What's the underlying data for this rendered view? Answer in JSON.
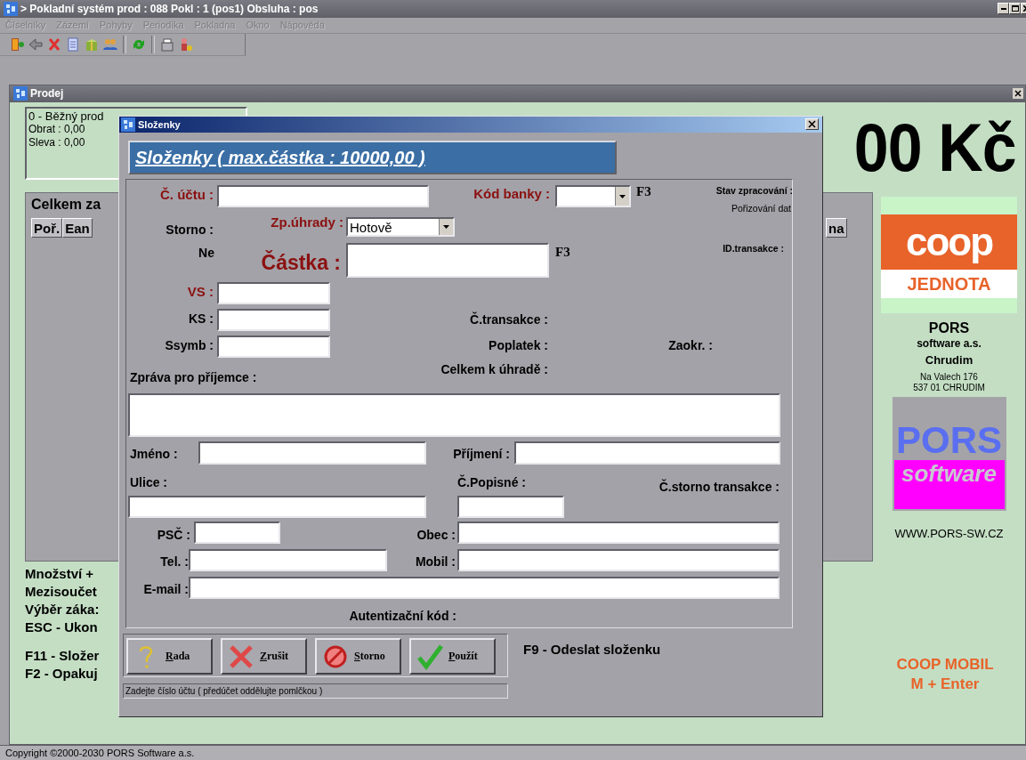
{
  "window": {
    "title": "> Pokladní systém prod : 088 Pokl : 1 (pos1) Obsluha : pos"
  },
  "menu": [
    {
      "label": "Číselníky",
      "disabled": true
    },
    {
      "label": "Zázemí",
      "disabled": true
    },
    {
      "label": "Pohyby",
      "disabled": true
    },
    {
      "label": "Periodika",
      "disabled": true
    },
    {
      "label": "Pokladna",
      "disabled": true
    },
    {
      "label": "Okno",
      "disabled": true
    },
    {
      "label": "Nápověda",
      "disabled": true
    }
  ],
  "sales_window": {
    "title": "Prodej",
    "info": [
      "0 - Běžný prod",
      "Obrat : 0,00",
      "Sleva : 0,00"
    ],
    "total": "00 Kč",
    "panel": {
      "title": "Celkem za",
      "columns": [
        "Poř.",
        "Ean",
        "na"
      ]
    },
    "shortcuts": [
      "Množství +",
      "Mezisoučet",
      "Výběr záka:",
      "ESC - Ukon",
      "F11 - Složer",
      "F2 - Opakuj"
    ],
    "vendor": {
      "store_logo": {
        "mark": "coop",
        "name": "JEDNOTA"
      },
      "company": "PORS",
      "company_sub": "software a.s.",
      "city": "Chrudim",
      "address": [
        "Na Valech 176",
        "537 01 CHRUDIM"
      ],
      "software_logo": {
        "mark": "PORS",
        "sub": "software"
      },
      "web": "WWW.PORS-SW.CZ"
    },
    "promo": [
      "COOP MOBIL",
      "M + Enter"
    ]
  },
  "dialog": {
    "title": "Složenky",
    "heading": "Složenky ( max.částka : 10000,00 )",
    "items": [
      {
        "kind": "required",
        "text": "Č. účtu :"
      },
      {
        "kind": "input"
      },
      {
        "kind": "required",
        "text": "Kód banky :"
      },
      {
        "kind": "select"
      },
      {
        "kind": "key",
        "text": "F3"
      },
      {
        "kind": "caption",
        "text": "Stav zpracování :"
      },
      {
        "kind": "note",
        "text": "Pořizování dat"
      },
      {
        "kind": "label",
        "text": "Storno :"
      },
      {
        "kind": "required",
        "text": "Zp.úhrady :"
      },
      {
        "kind": "select",
        "value": "Hotově"
      },
      {
        "kind": "label",
        "text": "Ne"
      },
      {
        "kind": "heading",
        "text": "Částka :"
      },
      {
        "kind": "input"
      },
      {
        "kind": "key",
        "text": "F3"
      },
      {
        "kind": "caption",
        "text": "ID.transakce :"
      },
      {
        "kind": "required",
        "text": "VS :"
      },
      {
        "kind": "input"
      },
      {
        "kind": "label",
        "text": "KS :"
      },
      {
        "kind": "input"
      },
      {
        "kind": "label",
        "text": "Ssymb :"
      },
      {
        "kind": "input"
      },
      {
        "kind": "label",
        "text": "Č.transakce :"
      },
      {
        "kind": "label",
        "text": "Poplatek :"
      },
      {
        "kind": "label",
        "text": "Zaokr. :"
      },
      {
        "kind": "label",
        "text": "Zpráva pro příjemce :"
      },
      {
        "kind": "label",
        "text": "Celkem k úhradě :"
      },
      {
        "kind": "textarea"
      },
      {
        "kind": "label",
        "text": "Jméno :"
      },
      {
        "kind": "input"
      },
      {
        "kind": "label",
        "text": "Příjmení :"
      },
      {
        "kind": "input"
      },
      {
        "kind": "label",
        "text": "Ulice :"
      },
      {
        "kind": "label",
        "text": "Č.Popisné :"
      },
      {
        "kind": "label",
        "text": "Č.storno transakce :"
      },
      {
        "kind": "input"
      },
      {
        "kind": "input"
      },
      {
        "kind": "label",
        "text": "PSČ :"
      },
      {
        "kind": "input"
      },
      {
        "kind": "label",
        "text": "Obec :"
      },
      {
        "kind": "input"
      },
      {
        "kind": "label",
        "text": "Tel. :"
      },
      {
        "kind": "input"
      },
      {
        "kind": "label",
        "text": "Mobil :"
      },
      {
        "kind": "input"
      },
      {
        "kind": "label",
        "text": "E-mail :"
      },
      {
        "kind": "input"
      },
      {
        "kind": "label",
        "text": "Autentizační kód :"
      }
    ],
    "buttons": [
      {
        "label": "Rada"
      },
      {
        "label": "Zrušit"
      },
      {
        "label": "Storno"
      },
      {
        "label": "Použít"
      }
    ],
    "hint": "Zadejte číslo účtu ( předúčet oddělujte pomlčkou )",
    "shortcut": "F9 - Odeslat složenku"
  },
  "status_bar": "Copyright ©2000-2030 PORS Software a.s."
}
